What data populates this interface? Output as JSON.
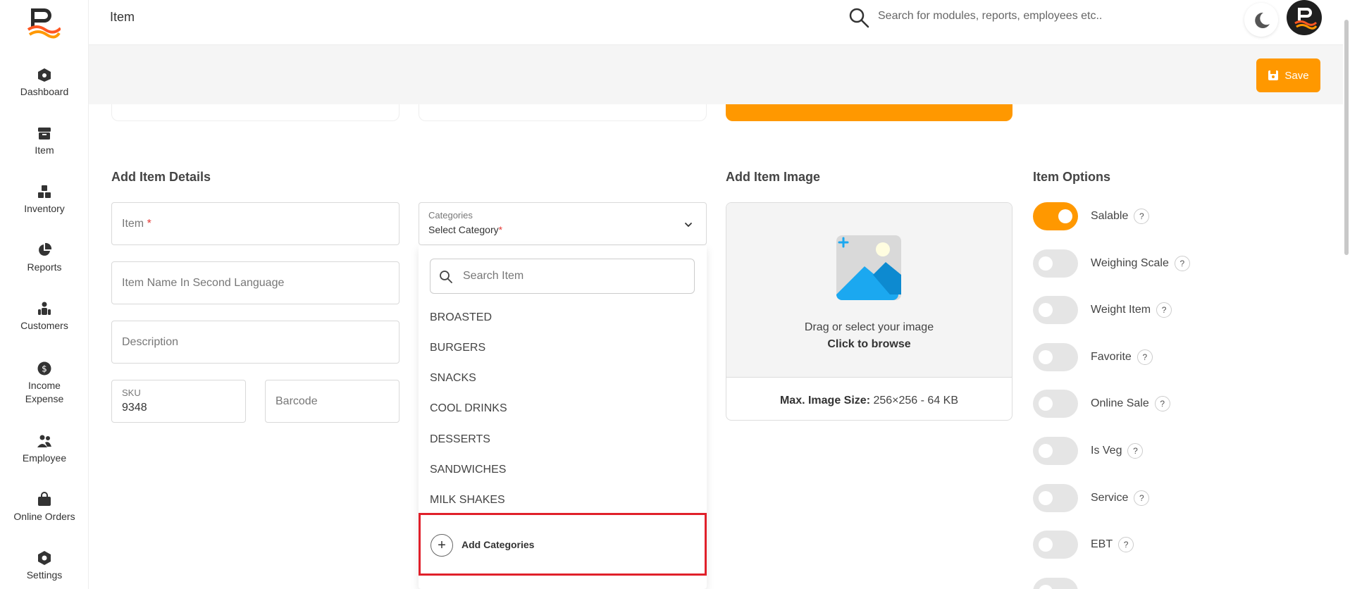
{
  "app": {
    "page_title": "Item",
    "search_placeholder": "Search for modules, reports, employees etc.."
  },
  "sidebar": {
    "items": [
      {
        "label": "Dashboard",
        "icon": "dashboard-icon"
      },
      {
        "label": "Item",
        "icon": "item-box-icon"
      },
      {
        "label": "Inventory",
        "icon": "inventory-icon"
      },
      {
        "label": "Reports",
        "icon": "pie-chart-icon"
      },
      {
        "label": "Customers",
        "icon": "customers-icon"
      },
      {
        "label": "Income Expense",
        "icon": "dollar-icon"
      },
      {
        "label": "Employee",
        "icon": "employee-icon"
      },
      {
        "label": "Online Orders",
        "icon": "bag-icon"
      },
      {
        "label": "Settings",
        "icon": "settings-icon"
      }
    ]
  },
  "toolbar": {
    "save_label": "Save"
  },
  "details": {
    "title": "Add Item Details",
    "item_placeholder": "Item",
    "item_required_mark": "*",
    "second_lang_placeholder": "Item Name In Second Language",
    "description_placeholder": "Description",
    "sku_label": "SKU",
    "sku_value": "9348",
    "barcode_placeholder": "Barcode"
  },
  "categories": {
    "label": "Categories",
    "value": "Select Category",
    "required_mark": "*",
    "search_placeholder": "Search Item",
    "options": [
      "BROASTED",
      "BURGERS",
      "SNACKS",
      "COOL DRINKS",
      "DESSERTS",
      "SANDWICHES",
      "MILK SHAKES"
    ],
    "add_label": "Add Categories"
  },
  "image": {
    "title": "Add Item Image",
    "drag_text": "Drag or select your image",
    "browse_text": "Click to browse",
    "max_label": "Max. Image Size:",
    "max_value": "256×256 - 64 KB"
  },
  "options": {
    "title": "Item Options",
    "help_mark": "?",
    "items": [
      {
        "label": "Salable",
        "on": true
      },
      {
        "label": "Weighing Scale",
        "on": false
      },
      {
        "label": "Weight Item",
        "on": false
      },
      {
        "label": "Favorite",
        "on": false
      },
      {
        "label": "Online Sale",
        "on": false
      },
      {
        "label": "Is Veg",
        "on": false
      },
      {
        "label": "Service",
        "on": false
      },
      {
        "label": "EBT",
        "on": false
      }
    ]
  },
  "colors": {
    "accent": "#ff9800",
    "highlight": "#e0202a"
  }
}
